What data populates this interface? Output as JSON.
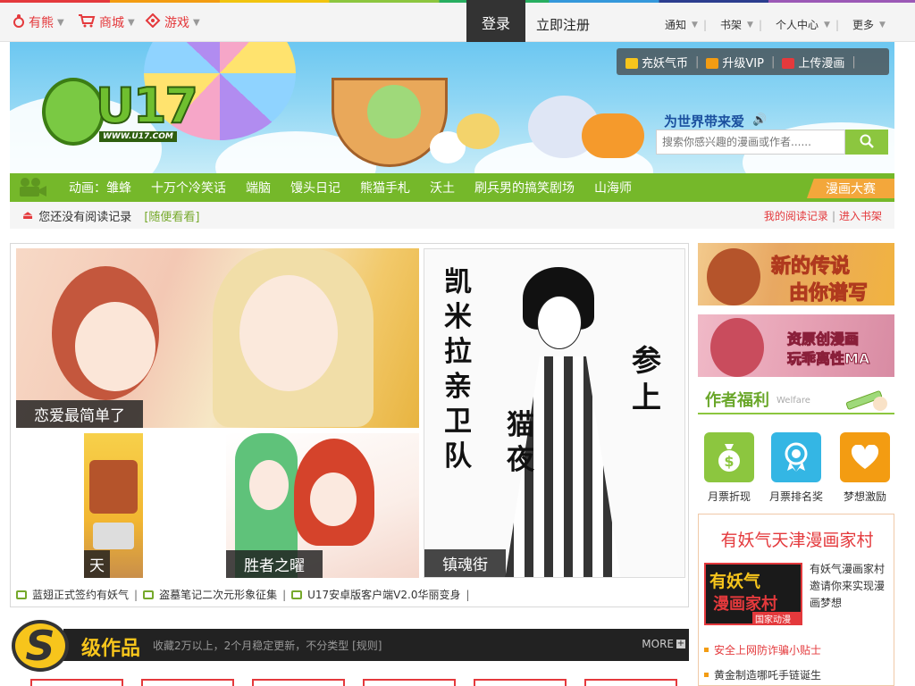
{
  "topbar": {
    "nav": [
      {
        "label": "有熊",
        "icon": "bear-paw-icon"
      },
      {
        "label": "商城",
        "icon": "cart-icon"
      },
      {
        "label": "游戏",
        "icon": "gamepad-icon"
      }
    ],
    "login_label": "登录",
    "register_label": "立即注册",
    "right_nav": [
      "通知",
      "书架",
      "个人中心",
      "更多"
    ]
  },
  "banner": {
    "logo_text": "U17",
    "logo_url": "WWW.U17.COM",
    "tools": [
      "充妖气币",
      "升级VIP",
      "上传漫画"
    ],
    "slogan": "为世界带来爱",
    "search_placeholder": "搜索你感兴趣的漫画或作者......"
  },
  "anim_bar": {
    "label": "动画：",
    "items": [
      "雏蜂",
      "十万个冷笑话",
      "端脑",
      "馒头日记",
      "熊猫手札",
      "沃土",
      "刷兵男的搞笑剧场",
      "山海师"
    ],
    "contest_label": "漫画大赛"
  },
  "history": {
    "empty_text": "您还没有阅读记录",
    "random_label": "[随便看看]",
    "my_records_label": "我的阅读记录",
    "bookshelf_label": "进入书架"
  },
  "gallery": {
    "captions": [
      "恋爱最简单了",
      "天",
      "胜者之曜",
      "镇魂街"
    ],
    "poster_text": [
      "凯米拉亲卫队",
      "参上",
      "猫夜"
    ],
    "ticker": [
      "蓝翅正式签约有妖气",
      "盗墓笔记二次元形象征集",
      "U17安卓版客户端V2.0华丽变身"
    ]
  },
  "s_section": {
    "badge": "S",
    "title": "级作品",
    "desc": "收藏2万以上，2个月稳定更新，不分类型 [规则]",
    "more_label": "MORE"
  },
  "sidebar": {
    "banner1_lines": [
      "新的传说",
      "由你谱写"
    ],
    "banner2_lines": [
      "资原创漫画",
      "玩乖离性MA"
    ],
    "welfare_title": "作者福利",
    "welfare_en": "Welfare",
    "welfare_items": [
      {
        "label": "月票折现",
        "icon": "money-bag-icon",
        "color": "#8cc63f"
      },
      {
        "label": "月票排名奖",
        "icon": "medal-icon",
        "color": "#34b6e4"
      },
      {
        "label": "梦想激励",
        "icon": "heart-icon",
        "color": "#f39c12"
      }
    ],
    "village_title": "有妖气天津漫画家村",
    "village_img_lines": [
      "有妖气",
      "漫画家村",
      "国家动漫园"
    ],
    "village_desc": "有妖气漫画家村邀请你来实现漫画梦想",
    "village_links": [
      "安全上网防诈骗小贴士",
      "黄金制造哪吒手链诞生"
    ]
  },
  "colors": {
    "accent_red": "#e4393c",
    "accent_green": "#75b82a",
    "accent_yellow": "#f7c51c"
  }
}
